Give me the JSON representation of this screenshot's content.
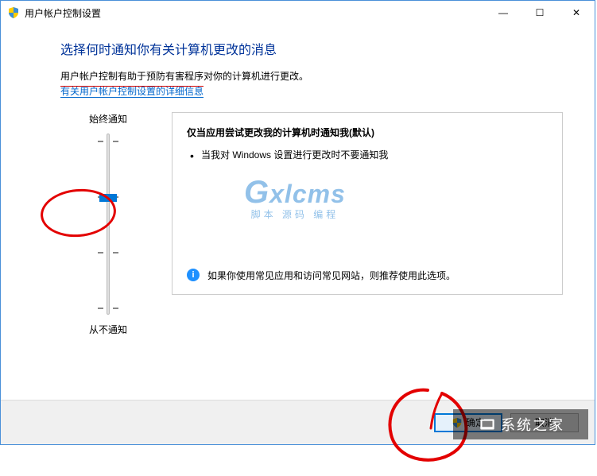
{
  "window": {
    "title": "用户帐户控制设置",
    "minimize": "—",
    "maximize": "☐",
    "close": "✕"
  },
  "heading": "选择何时通知你有关计算机更改的消息",
  "subtext": "用户帐户控制有助于预防有害程序对你的计算机进行更改。",
  "link": "有关用户帐户控制设置的详细信息",
  "slider": {
    "topLabel": "始终通知",
    "bottomLabel": "从不通知"
  },
  "desc": {
    "title": "仅当应用尝试更改我的计算机时通知我(默认)",
    "bullet1": "当我对 Windows 设置进行更改时不要通知我",
    "infoText": "如果你使用常见应用和访问常见网站，则推荐使用此选项。"
  },
  "watermark": {
    "main": "Gxlcms",
    "sub": "脚本 源码 编程"
  },
  "footer": {
    "ok": "确定",
    "cancel": "取消"
  },
  "overlayLogo": "系统之家"
}
